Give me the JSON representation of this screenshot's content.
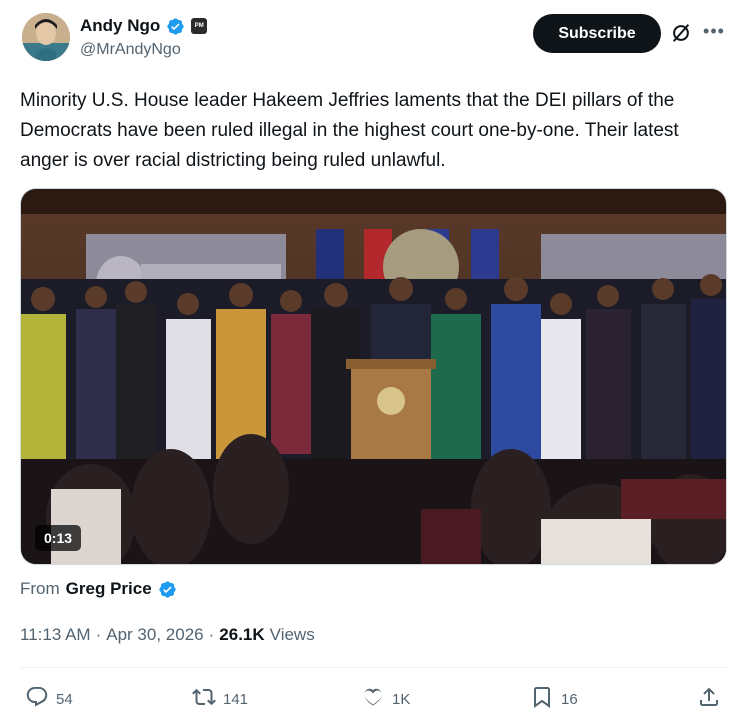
{
  "author": {
    "display_name": "Andy Ngo",
    "handle": "@MrAndyNgo",
    "affiliate_badge": "PM"
  },
  "subscribe_label": "Subscribe",
  "tweet_text": "Minority U.S. House leader Hakeem Jeffries laments that the DEI pillars of the Democrats have been ruled illegal in the highest court one-by-one. Their latest anger is over racial districting being ruled unlawful.",
  "media": {
    "duration": "0:13"
  },
  "attribution": {
    "prefix": "From",
    "name": "Greg Price"
  },
  "meta": {
    "time": "11:13 AM",
    "separator1": "·",
    "date": "Apr 30, 2026",
    "separator2": "·",
    "views_count": "26.1K",
    "views_label": "Views"
  },
  "actions": {
    "replies": "54",
    "reposts": "141",
    "likes": "1K",
    "bookmarks": "16"
  },
  "colors": {
    "verified_blue": "#1d9bf0",
    "subscribe_bg": "#0f1419",
    "secondary_text": "#536471"
  }
}
